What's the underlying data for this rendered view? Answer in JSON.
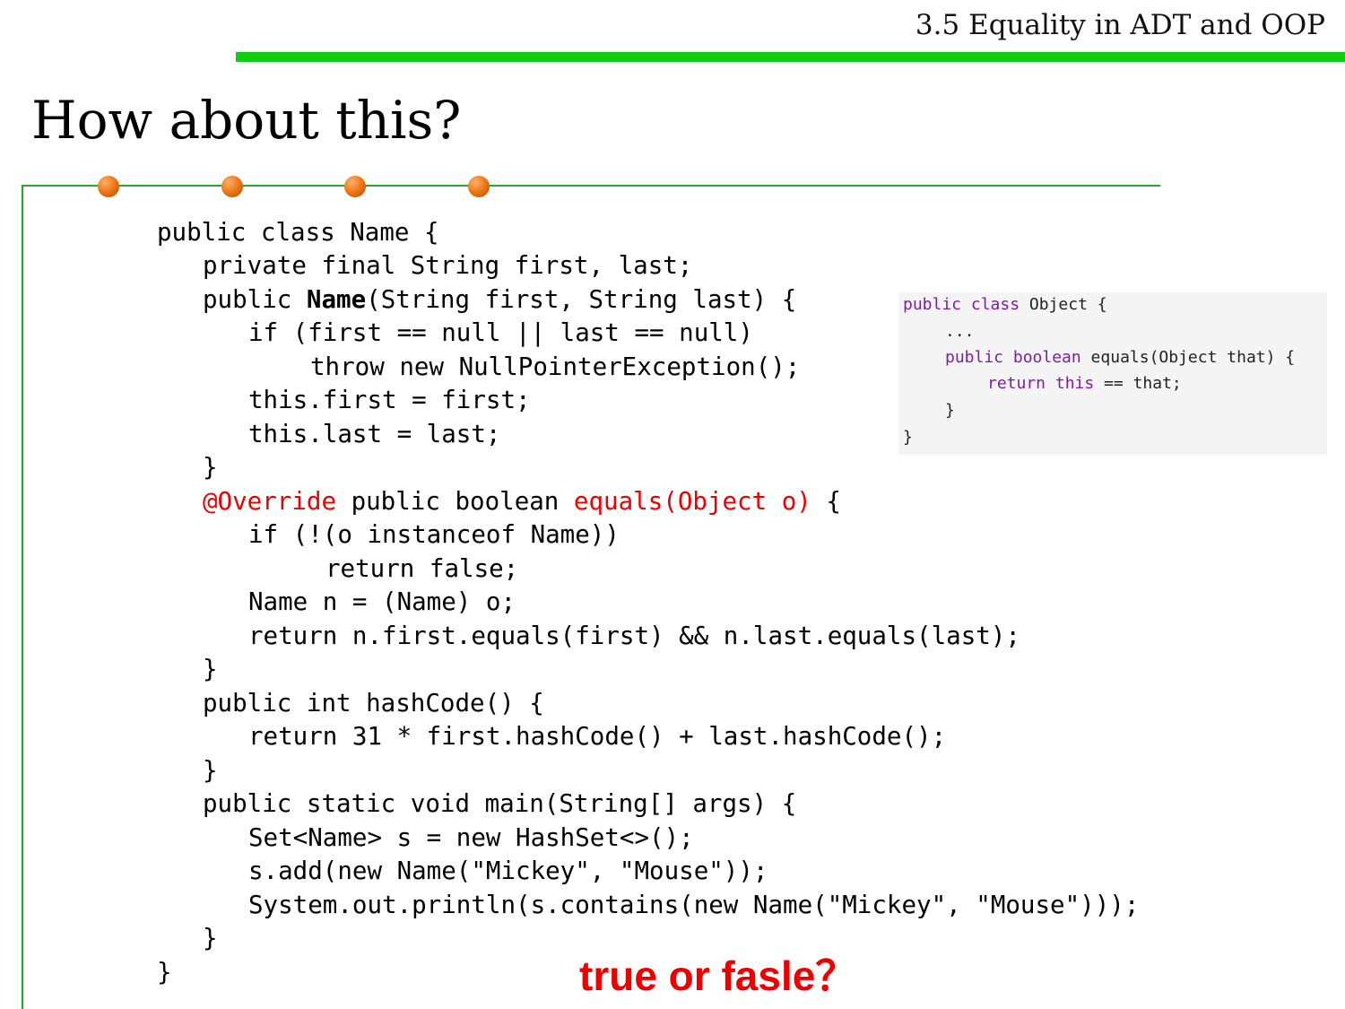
{
  "header": {
    "title": "3.5 Equality in ADT and OOP",
    "bar_color": "#11cc11"
  },
  "slide": {
    "title": "How about this?"
  },
  "decor": {
    "frame_color": "#22aa22",
    "dot_color": "#f07a18",
    "dot_count": 4
  },
  "code": {
    "lines": [
      "public class Name {",
      "private final String first, last;",
      "public ",
      "Name",
      "(String first, String last) {",
      "if (first == null || last == null)",
      "throw new NullPointerException();",
      "this.first = first;",
      "this.last = last;",
      "}",
      "@Override",
      " public boolean ",
      "equals(Object o)",
      " {",
      "if (!(o instanceof Name))",
      "return false;",
      "Name n = (Name) o;",
      "return n.first.equals(first) && n.last.equals(last);",
      "}",
      "public int hashCode() {",
      "return 31 * first.hashCode() + last.hashCode();",
      "}",
      "public static void main(String[] args) {",
      "Set<Name> s = new HashSet<>();",
      "s.add(new Name(\"Mickey\", \"Mouse\"));",
      "System.out.println(s.contains(new Name(\"Mickey\", \"Mouse\")));",
      "}",
      "}"
    ],
    "highlight_color": "#ee0000"
  },
  "object_snippet": {
    "l1_kw": "public class",
    "l1_rest": " Object {",
    "l2": "...",
    "l3_kw": "public boolean",
    "l3_rest": " equals(Object that) {",
    "l4_kw": "return this",
    "l4_rest": " == that;",
    "l5": "}",
    "l6": "}",
    "keyword_color": "#7a1fa2"
  },
  "answer": {
    "text": "true or fasle？",
    "color": "#ee0000"
  }
}
